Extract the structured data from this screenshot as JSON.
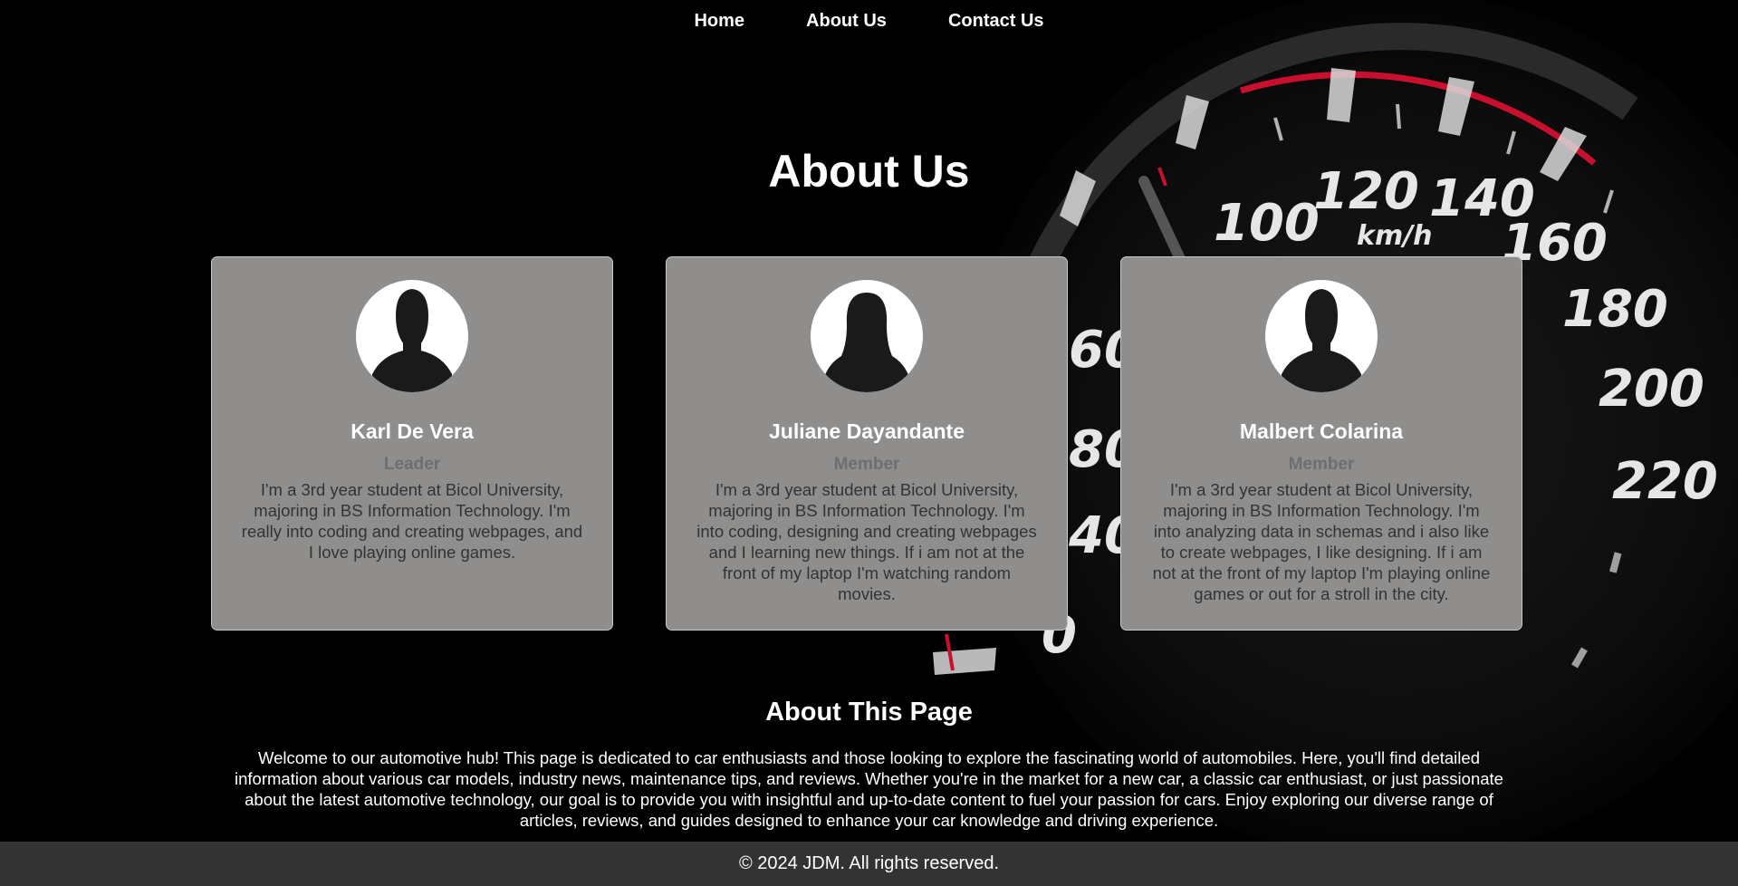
{
  "nav": {
    "items": [
      {
        "label": "Home"
      },
      {
        "label": "About Us"
      },
      {
        "label": "Contact Us"
      }
    ]
  },
  "main": {
    "title": "About Us",
    "team": [
      {
        "name": "Karl De Vera",
        "role": "Leader",
        "avatar_icon": "male-silhouette-icon",
        "bio": "I'm a 3rd year student at Bicol University, majoring in BS Information Technology. I'm really into coding and creating webpages, and I love playing online games."
      },
      {
        "name": "Juliane Dayandante",
        "role": "Member",
        "avatar_icon": "female-silhouette-icon",
        "bio": "I'm a 3rd year student at Bicol University, majoring in BS Information Technology. I'm into coding, designing and creating webpages and I learning new things. If i am not at the front of my laptop I'm watching random movies."
      },
      {
        "name": "Malbert Colarina",
        "role": "Member",
        "avatar_icon": "male-silhouette-icon",
        "bio": "I'm a 3rd year student at Bicol University, majoring in BS Information Technology. I'm into analyzing data in schemas and i also like to create webpages, I like designing. If i am not at the front of my laptop I'm playing online games or out for a stroll in the city."
      }
    ]
  },
  "about_page": {
    "heading": "About This Page",
    "text": "Welcome to our automotive hub! This page is dedicated to car enthusiasts and those looking to explore the fascinating world of automobiles. Here, you'll find detailed information about various car models, industry news, maintenance tips, and reviews. Whether you're in the market for a new car, a classic car enthusiast, or just passionate about the latest automotive technology, our goal is to provide you with insightful and up-to-date content to fuel your passion for cars. Enjoy exploring our diverse range of articles, reviews, and guides designed to enhance your car knowledge and driving experience."
  },
  "background": {
    "gauge_labels": [
      "60",
      "80",
      "100",
      "120",
      "140",
      "160",
      "180",
      "200",
      "220",
      "0"
    ],
    "gauge_unit": "km/h"
  },
  "footer": {
    "text": "© 2024 JDM. All rights reserved."
  },
  "colors": {
    "card_bg": "#8f8e8c",
    "footer_bg": "#333333",
    "gauge_red": "#c8102e"
  }
}
